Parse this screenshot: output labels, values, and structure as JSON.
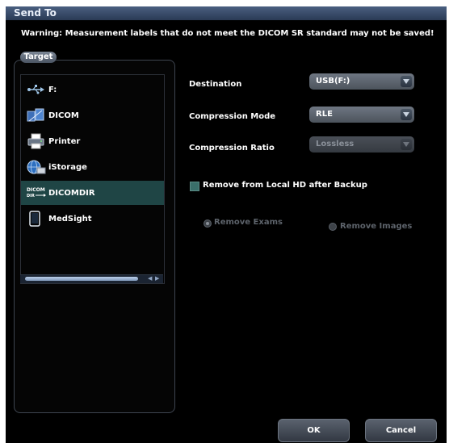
{
  "dialog": {
    "title": "Send To",
    "warning": "Warning: Measurement labels that do not meet the DICOM SR standard may not be saved!"
  },
  "target": {
    "tab_label": "Target",
    "items": [
      {
        "label": "F:",
        "icon": "usb-icon",
        "selected": false
      },
      {
        "label": "DICOM",
        "icon": "dicom-network-icon",
        "selected": false
      },
      {
        "label": "Printer",
        "icon": "printer-icon",
        "selected": false
      },
      {
        "label": "iStorage",
        "icon": "istorage-icon",
        "selected": false
      },
      {
        "label": "DICOMDIR",
        "icon": "dicomdir-icon",
        "selected": true
      },
      {
        "label": "MedSight",
        "icon": "tablet-icon",
        "selected": false
      }
    ]
  },
  "settings": {
    "destination_label": "Destination",
    "destination_value": "USB(F:)",
    "compression_mode_label": "Compression Mode",
    "compression_mode_value": "RLE",
    "compression_ratio_label": "Compression Ratio",
    "compression_ratio_value": "Lossless",
    "remove_local_label": "Remove from Local HD after Backup",
    "remove_exams_label": "Remove Exams",
    "remove_images_label": "Remove Images"
  },
  "buttons": {
    "ok": "OK",
    "cancel": "Cancel"
  },
  "colors": {
    "background": "#000000",
    "titlebar": "#3a4d6a",
    "selected_row": "#1f4545"
  }
}
